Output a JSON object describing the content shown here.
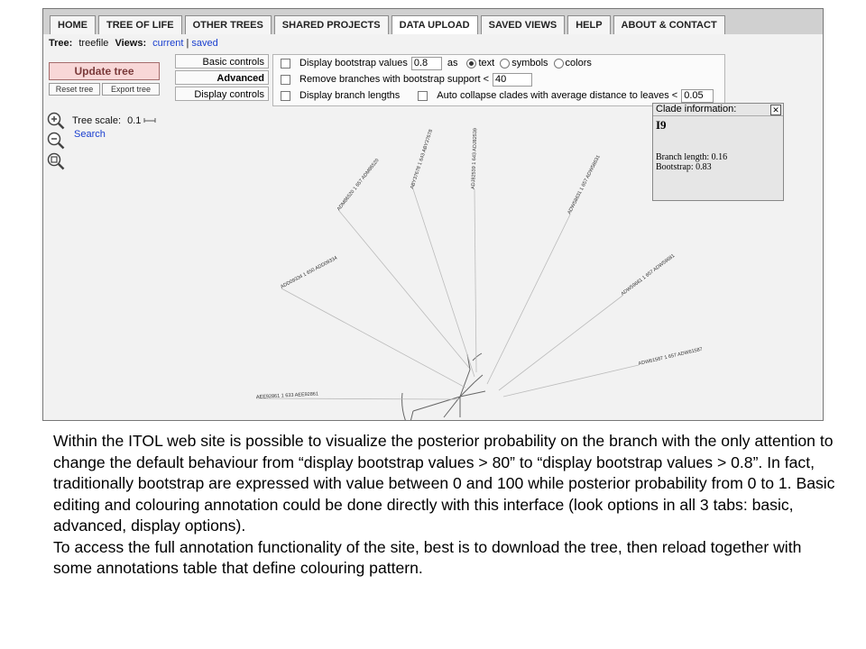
{
  "nav": {
    "tabs": [
      "HOME",
      "TREE OF LIFE",
      "OTHER TREES",
      "SHARED PROJECTS",
      "DATA UPLOAD",
      "SAVED VIEWS",
      "HELP",
      "ABOUT & CONTACT"
    ],
    "active_tab": "DATA UPLOAD"
  },
  "tree_bar": {
    "tree_label": "Tree:",
    "tree_name": "treefile",
    "views_label": "Views:",
    "current": "current",
    "separator": "|",
    "saved": "saved"
  },
  "buttons": {
    "update": "Update tree",
    "reset": "Reset tree",
    "export": "Export tree"
  },
  "control_tabs": {
    "basic": "Basic controls",
    "advanced": "Advanced controls",
    "display": "Display controls"
  },
  "controls": {
    "bootstrap_label": "Display bootstrap values",
    "bootstrap_value": "0.8",
    "as_label": "as",
    "radio_text": "text",
    "radio_symbols": "symbols",
    "radio_colors": "colors",
    "remove_label": "Remove branches with bootstrap support <",
    "remove_value": "40",
    "branch_lengths_label": "Display branch lengths",
    "autocollapse_label": "Auto collapse clades with average distance to leaves <",
    "autocollapse_value": "0.05"
  },
  "tree_scale": {
    "label": "Tree scale:",
    "value": "0.1",
    "search": "Search"
  },
  "clade_info": {
    "title": "Clade information:",
    "close": "✕",
    "name": "I9",
    "branch_length": "Branch length: 0.16",
    "bootstrap": "Bootstrap: 0.83"
  },
  "leaves": [
    "ABY37678 1 643 ABY37678",
    "ADJ82539 1 643 ADJ82539",
    "ADM86520 1 657 ADM86520",
    "ADW58631 1 657 ADW58631",
    "ADD09334 1 650 ADD09334",
    "ADW59681 1 657 ADW59681",
    "ADW61587 1 657 ADW61587",
    "AEE92861 1 633 AEE92861"
  ],
  "caption": {
    "p1": "Within the ITOL web site is possible to visualize the posterior probability on the branch with the only attention  to change the default behaviour  from “display bootstrap values > 80” to “display bootstrap values > 0.8”. In fact, traditionally bootstrap are expressed with value between 0 and 100 while posterior probability from 0 to 1. Basic editing and colouring annotation could be done directly with this interface (look options in all 3 tabs: basic, advanced, display options).",
    "p2": "To access the full annotation functionality of the site, best is to download the tree, then reload together with  some annotations table that define colouring pattern."
  }
}
